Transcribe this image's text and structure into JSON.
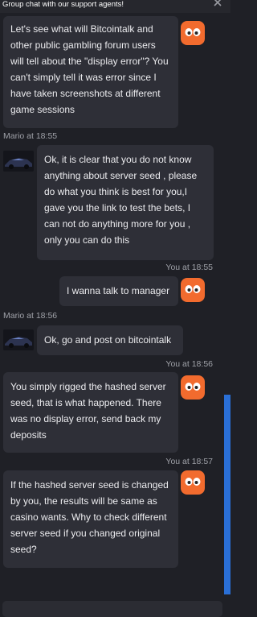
{
  "header": {
    "title": "Group chat with our support agents!"
  },
  "messages": [
    {
      "sender": "user",
      "text": "Let's see what will Bitcointalk and\nother public gambling forum users\nwill tell about the \"display error\"? You\ncan't simply tell it was error since I\nhave taken screenshots at different\ngame sessions"
    },
    {
      "sender": "Mario",
      "meta": "Mario at 18:55",
      "text": "Ok, it is clear that you do not know\nanything about server seed , please\ndo what you think is best for you,I\ngave you the link to test the bets, I\ncan not do anything more for you ,\nonly you can do this"
    },
    {
      "sender": "You",
      "meta": "You at 18:55",
      "text": "I wanna talk to manager"
    },
    {
      "sender": "Mario",
      "meta": "Mario at 18:56",
      "text": "Ok, go and post on bitcointalk"
    },
    {
      "sender": "You",
      "meta": "You at 18:56",
      "text": "You simply rigged the hashed server\nseed, that is what happened. There\nwas no display error, send back my\ndeposits"
    },
    {
      "sender": "You",
      "meta": "You at 18:57",
      "text": "If the hashed server seed is changed\nby you, the results will be same as\ncasino wants. Why to check different\nserver seed if you changed original\nseed?"
    }
  ],
  "icons": {
    "close": "close-icon",
    "user_avatar": "smiley-face-icon",
    "agent_avatar": "car-avatar-icon"
  },
  "colors": {
    "background": "#1f2026",
    "bubble": "#2e2f37",
    "avatar": "#f26b2e",
    "scrollbar": "#2a6fd6"
  }
}
